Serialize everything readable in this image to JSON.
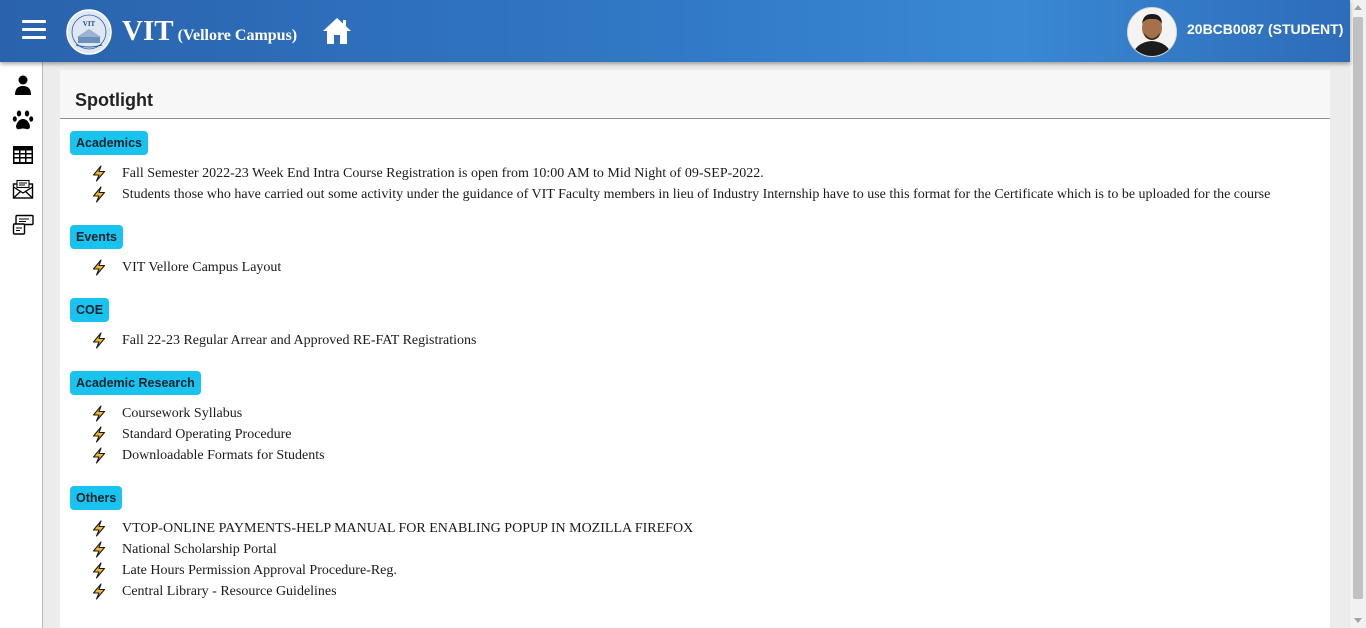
{
  "header": {
    "brand_title": "VIT",
    "brand_subtitle": "(Vellore Campus)",
    "logo_text": "VIT",
    "user_label": "20BCB0087 (STUDENT)"
  },
  "sidebar": {
    "icons": [
      "profile-icon",
      "paw-icon",
      "table-icon",
      "mail-icon",
      "chat-icon"
    ]
  },
  "main": {
    "title": "Spotlight",
    "sections": [
      {
        "label": "Academics",
        "items": [
          "Fall Semester 2022-23 Week End Intra Course Registration is open from 10:00 AM to Mid Night of 09-SEP-2022.",
          "Students those who have carried out some activity under the guidance of VIT Faculty members in lieu of Industry Internship have to use this format for the Certificate which is to be uploaded for the course"
        ]
      },
      {
        "label": "Events",
        "items": [
          "VIT Vellore Campus Layout"
        ]
      },
      {
        "label": "COE",
        "items": [
          "Fall 22-23 Regular Arrear and Approved RE-FAT Registrations"
        ]
      },
      {
        "label": "Academic Research",
        "items": [
          "Coursework Syllabus",
          "Standard Operating Procedure",
          "Downloadable Formats for Students"
        ]
      },
      {
        "label": "Others",
        "items": [
          "VTOP-ONLINE PAYMENTS-HELP MANUAL FOR ENABLING POPUP IN MOZILLA FIREFOX",
          "National Scholarship Portal",
          "Late Hours Permission Approval Procedure-Reg.",
          "Central Library - Resource Guidelines"
        ]
      }
    ]
  },
  "colors": {
    "header_gradient_start": "#2a62ad",
    "header_gradient_end": "#3a88d4",
    "badge": "#18c4ef",
    "bolt_fill": "#f5b82e"
  }
}
